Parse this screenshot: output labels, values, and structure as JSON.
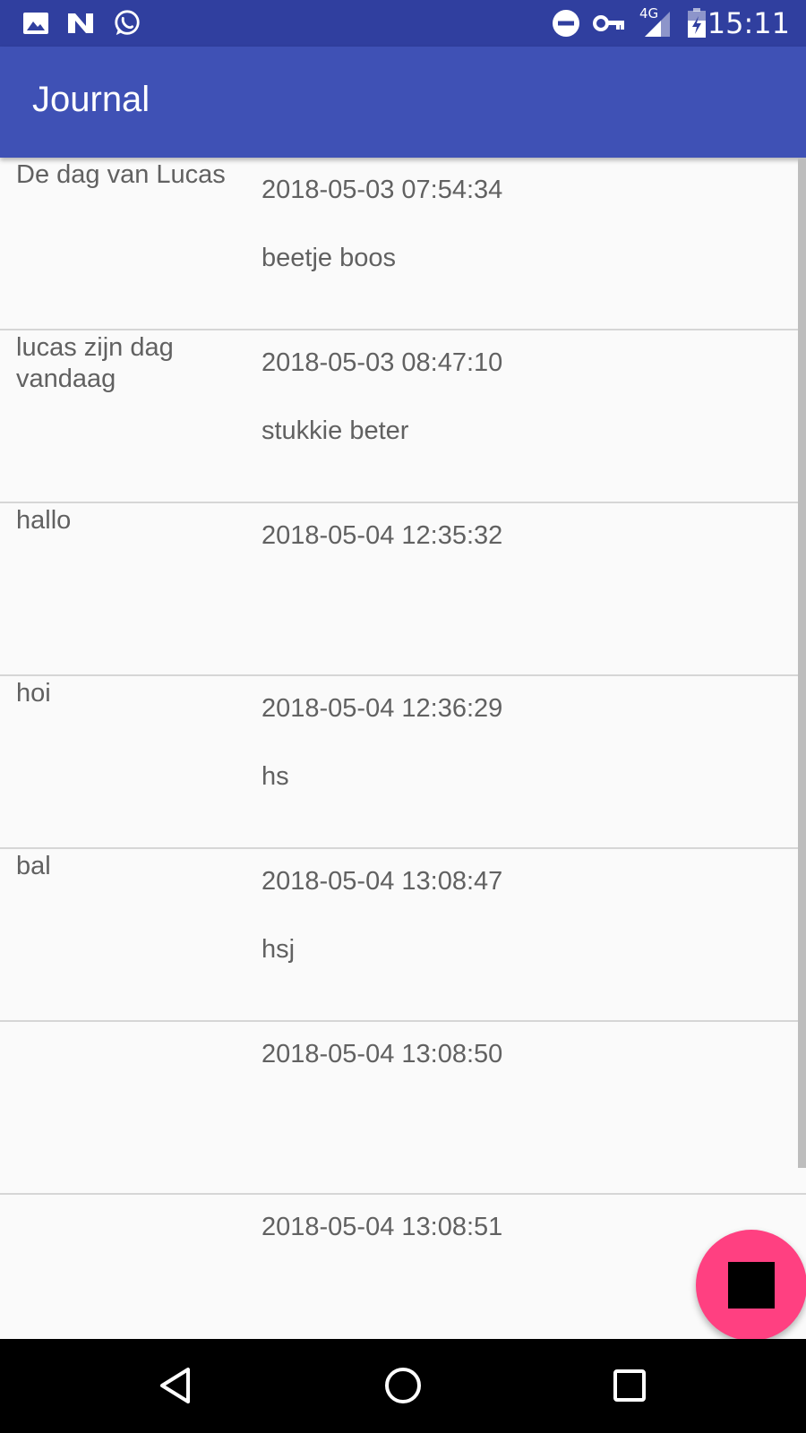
{
  "status_bar": {
    "time": "15:11",
    "network_label": "4G",
    "icons": [
      "image-icon",
      "n-app-icon",
      "whatsapp-icon",
      "do-not-disturb-icon",
      "vpn-key-icon",
      "signal-icon",
      "battery-icon"
    ],
    "color": "#303f9f"
  },
  "app_bar": {
    "title": "Journal",
    "color": "#3f51b5"
  },
  "entries": [
    {
      "title": "De dag van Lucas",
      "date": "2018-05-03 07:54:34",
      "note": "beetje boos"
    },
    {
      "title": "lucas zijn dag vandaag",
      "date": "2018-05-03 08:47:10",
      "note": "stukkie beter"
    },
    {
      "title": "hallo",
      "date": "2018-05-04 12:35:32",
      "note": ""
    },
    {
      "title": "hoi",
      "date": "2018-05-04 12:36:29",
      "note": "hs"
    },
    {
      "title": "bal",
      "date": "2018-05-04 13:08:47",
      "note": "hsj"
    },
    {
      "title": "",
      "date": "2018-05-04 13:08:50",
      "note": ""
    },
    {
      "title": "",
      "date": "2018-05-04 13:08:51",
      "note": ""
    }
  ],
  "fab": {
    "icon": "stop-icon",
    "color": "#ff4081"
  },
  "nav_bar": {
    "icons": [
      "back-icon",
      "home-icon",
      "recents-icon"
    ]
  }
}
